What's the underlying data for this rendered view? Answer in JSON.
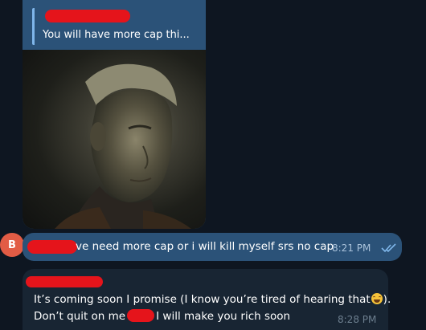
{
  "conversation": {
    "media_message": {
      "reply_preview_text": "You will have more cap thi...",
      "image_description_icon": "photo-icon"
    },
    "avatar": {
      "initial": "B",
      "color": "#e25c45"
    },
    "outgoing_message": {
      "text": "ve need more cap or i will kill myself srs no cap",
      "time": "8:21 PM",
      "status_icon": "double-check-icon"
    },
    "incoming_message": {
      "line1": "It’s coming soon I promise (I know you’re tired of hearing that",
      "line1_end": ").",
      "line2_start": "Don’t quit on me",
      "line2_end": "I will make you rich soon",
      "time": "8:28 PM",
      "emoji_icon": "laughing-emoji-icon"
    }
  },
  "colors": {
    "background": "#0e1621",
    "outgoing_bubble": "#2b5278",
    "incoming_bubble": "#182533",
    "redaction": "#e5141b",
    "accent": "#7fb6ea"
  }
}
